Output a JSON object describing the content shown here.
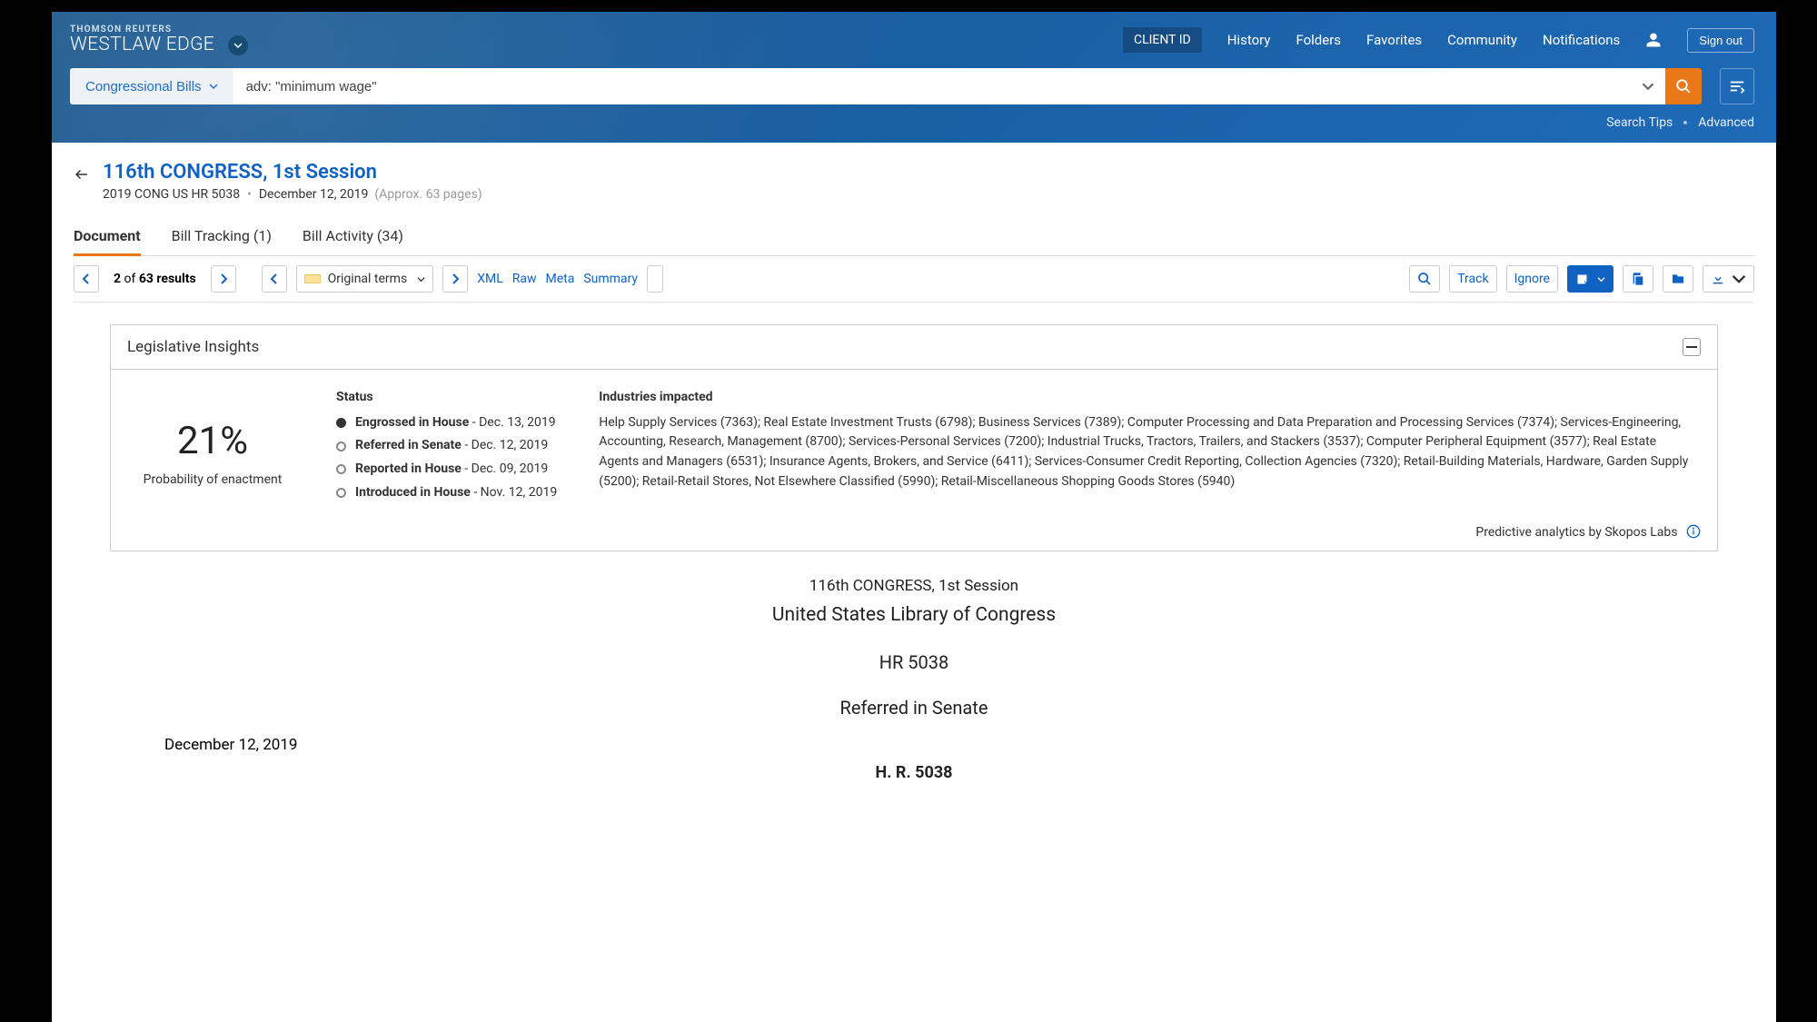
{
  "brand": {
    "sub": "THOMSON REUTERS",
    "main": "WESTLAW EDGE"
  },
  "nav": {
    "client_id": "CLIENT ID",
    "links": [
      "History",
      "Folders",
      "Favorites",
      "Community",
      "Notifications"
    ],
    "signout": "Sign out"
  },
  "search": {
    "scope": "Congressional Bills",
    "query": "adv: \"minimum wage\"",
    "tips": "Search Tips",
    "advanced": "Advanced"
  },
  "doc": {
    "title": "116th CONGRESS, 1st Session",
    "cite": "2019 CONG US HR 5038",
    "date": "December 12, 2019",
    "pages": "(Approx. 63 pages)"
  },
  "tabs": {
    "document": "Document",
    "tracking": "Bill Tracking (1)",
    "activity": "Bill Activity (34)"
  },
  "toolbar": {
    "count_prefix": "2",
    "count_of": "of",
    "count_total": "63 results",
    "original_terms": "Original terms",
    "links": [
      "XML",
      "Raw",
      "Meta",
      "Summary"
    ],
    "track": "Track",
    "ignore": "Ignore"
  },
  "insights": {
    "title": "Legislative Insights",
    "prob": "21%",
    "prob_label": "Probability of enactment",
    "status_h": "Status",
    "status": [
      {
        "name": "Engrossed in House",
        "date": "Dec. 13, 2019",
        "fill": true
      },
      {
        "name": "Referred in Senate",
        "date": "Dec. 12, 2019",
        "fill": false
      },
      {
        "name": "Reported in House",
        "date": "Dec. 09, 2019",
        "fill": false
      },
      {
        "name": "Introduced in House",
        "date": "Nov. 12, 2019",
        "fill": false
      }
    ],
    "ind_h": "Industries impacted",
    "industries": "Help Supply Services (7363); Real Estate Investment Trusts (6798); Business Services (7389); Computer Processing and Data Preparation and Processing Services (7374); Services-Engineering, Accounting, Research, Management (8700); Services-Personal Services (7200); Industrial Trucks, Tractors, Trailers, and Stackers (3537); Computer Peripheral Equipment (3577); Real Estate Agents and Managers (6531); Insurance Agents, Brokers, and Service (6411); Services-Consumer Credit Reporting, Collection Agencies (7320); Retail-Building Materials, Hardware, Garden Supply (5200); Retail-Retail Stores, Not Elsewhere Classified (5990); Retail-Miscellaneous Shopping Goods Stores (5940)",
    "credit": "Predictive analytics by Skopos Labs"
  },
  "bill": {
    "l1": "116th CONGRESS, 1st Session",
    "l2": "United States Library of Congress",
    "l3": "HR 5038",
    "l4": "Referred in Senate",
    "date": "December 12, 2019",
    "l5": "H. R. 5038"
  }
}
